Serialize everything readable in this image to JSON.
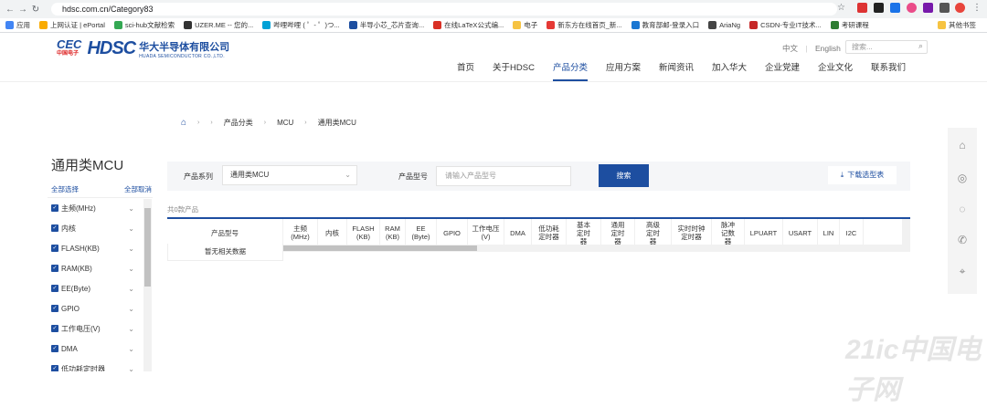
{
  "browser": {
    "url": "hdsc.com.cn/Category83",
    "bookmarks": [
      "应用",
      "上网认证 | ePortal",
      "sci-hub文献检索",
      "UZER.ME -- 您的...",
      "哔哩哔哩 ( ゜- ゜)つ...",
      "半导小芯_芯片查询...",
      "在线LaTeX公式编...",
      "电子",
      "新东方在线首页_新...",
      "教育部邮-登录入口",
      "AriaNg",
      "CSDN-专业IT技术...",
      "考研课程",
      "其他书签"
    ],
    "colors": {
      "accent": "#1d4ea0"
    }
  },
  "header": {
    "logo_cec": "CEC",
    "logo_cec_sub": "中国电子",
    "logo_hdsc": "HDSC",
    "logo_cn": "华大半导体有限公司",
    "logo_en": "HUADA SEMICONDUCTOR CO.,LTD.",
    "lang_cn": "中文",
    "lang_en": "English",
    "search_placeholder": "搜索...",
    "nav": [
      "首页",
      "关于HDSC",
      "产品分类",
      "应用方案",
      "新闻资讯",
      "加入华大",
      "企业党建",
      "企业文化",
      "联系我们"
    ],
    "nav_active": "产品分类"
  },
  "breadcrumb": [
    "产品分类",
    "MCU",
    "通用类MCU"
  ],
  "sidebar": {
    "title": "通用类MCU",
    "select_all": "全部选择",
    "cancel_all": "全部取消",
    "items": [
      "主频(MHz)",
      "内核",
      "FLASH(KB)",
      "RAM(KB)",
      "EE(Byte)",
      "GPIO",
      "工作电压(V)",
      "DMA",
      "低功耗定时器"
    ]
  },
  "filter": {
    "series_label": "产品系列",
    "series_value": "通用类MCU",
    "model_label": "产品型号",
    "model_placeholder": "请输入产品型号",
    "search_button": "搜索",
    "download_button": "下载选型表"
  },
  "results": {
    "count_text": "共0款产品",
    "columns": [
      "产品型号",
      "主频 (MHz)",
      "内核",
      "FLASH (KB)",
      "RAM (KB)",
      "EE (Byte)",
      "GPIO",
      "工作电压 (V)",
      "DMA",
      "低功耗 定时器",
      "基本 定时器",
      "通用 定时器",
      "高级 定时器",
      "实时时钟 定时器",
      "脉冲 记数器",
      "LPUART",
      "USART",
      "LIN",
      "I2C"
    ],
    "empty_text": "暂无相关数据"
  },
  "watermark": "21ic中国电子网"
}
